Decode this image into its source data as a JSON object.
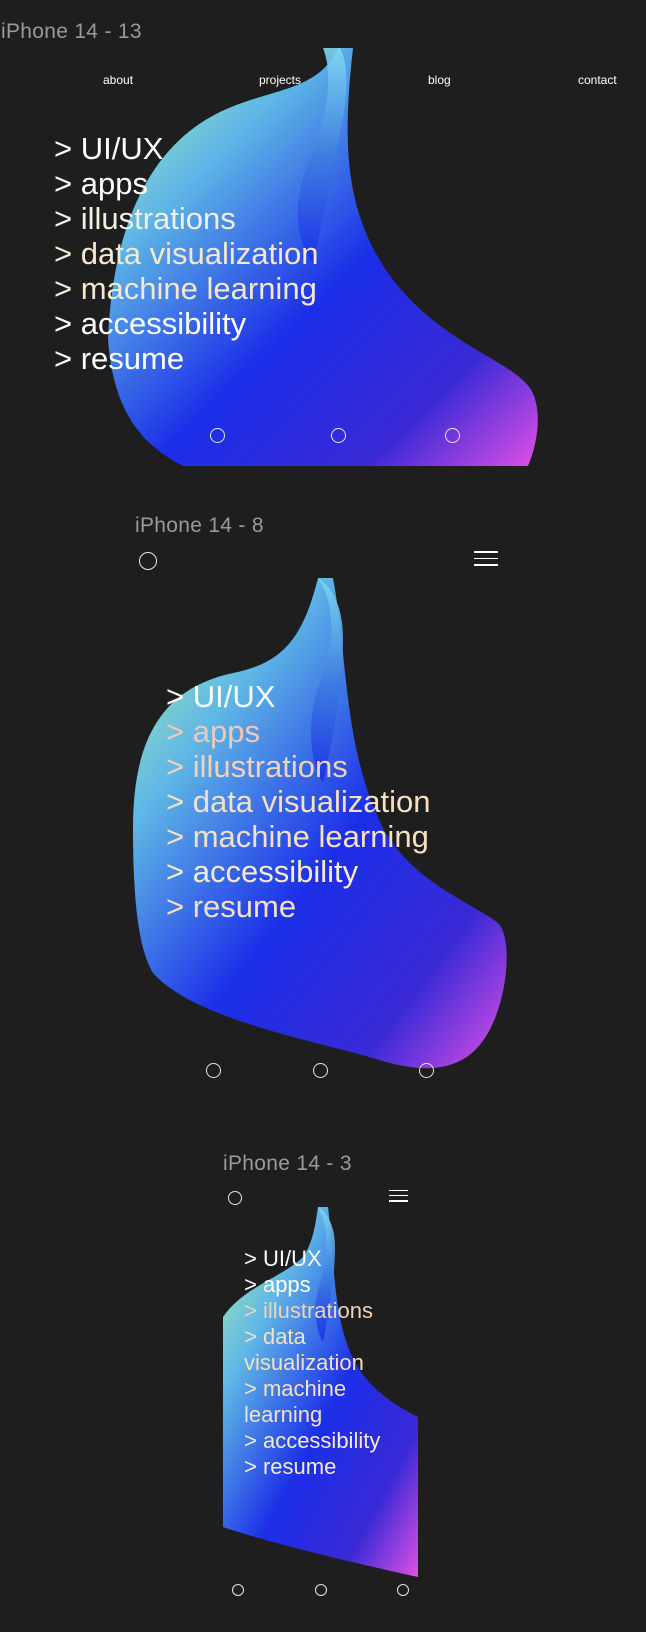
{
  "frames": [
    {
      "title": "iPhone 14 - 13",
      "nav": {
        "about": "about",
        "projects": "projects",
        "blog": "blog",
        "contact": "contact"
      },
      "menu_items": [
        "> UI/UX",
        "> apps",
        "> illustrations",
        "> data visualization",
        "> machine learning",
        "> accessibility",
        "> resume"
      ]
    },
    {
      "title": "iPhone 14 - 8",
      "menu_items": [
        "> UI/UX",
        "> apps",
        "> illustrations",
        "> data visualization",
        "> machine learning",
        "> accessibility",
        "> resume"
      ]
    },
    {
      "title": "iPhone 14 - 3",
      "menu_items": [
        "> UI/UX",
        "> apps",
        "> illustrations",
        "> data visualization",
        "> machine learning",
        "> accessibility",
        "> resume"
      ]
    }
  ],
  "colors": {
    "background": "#1e1e1e",
    "frame_title": "#9a9a9a",
    "text": "#ffffff",
    "gradient_mint": "#b5f5a8",
    "gradient_blue": "#1b2ee8",
    "gradient_magenta": "#e050e6"
  },
  "icons": {
    "slide_dot": "circle-outline",
    "menu": "hamburger-icon"
  }
}
